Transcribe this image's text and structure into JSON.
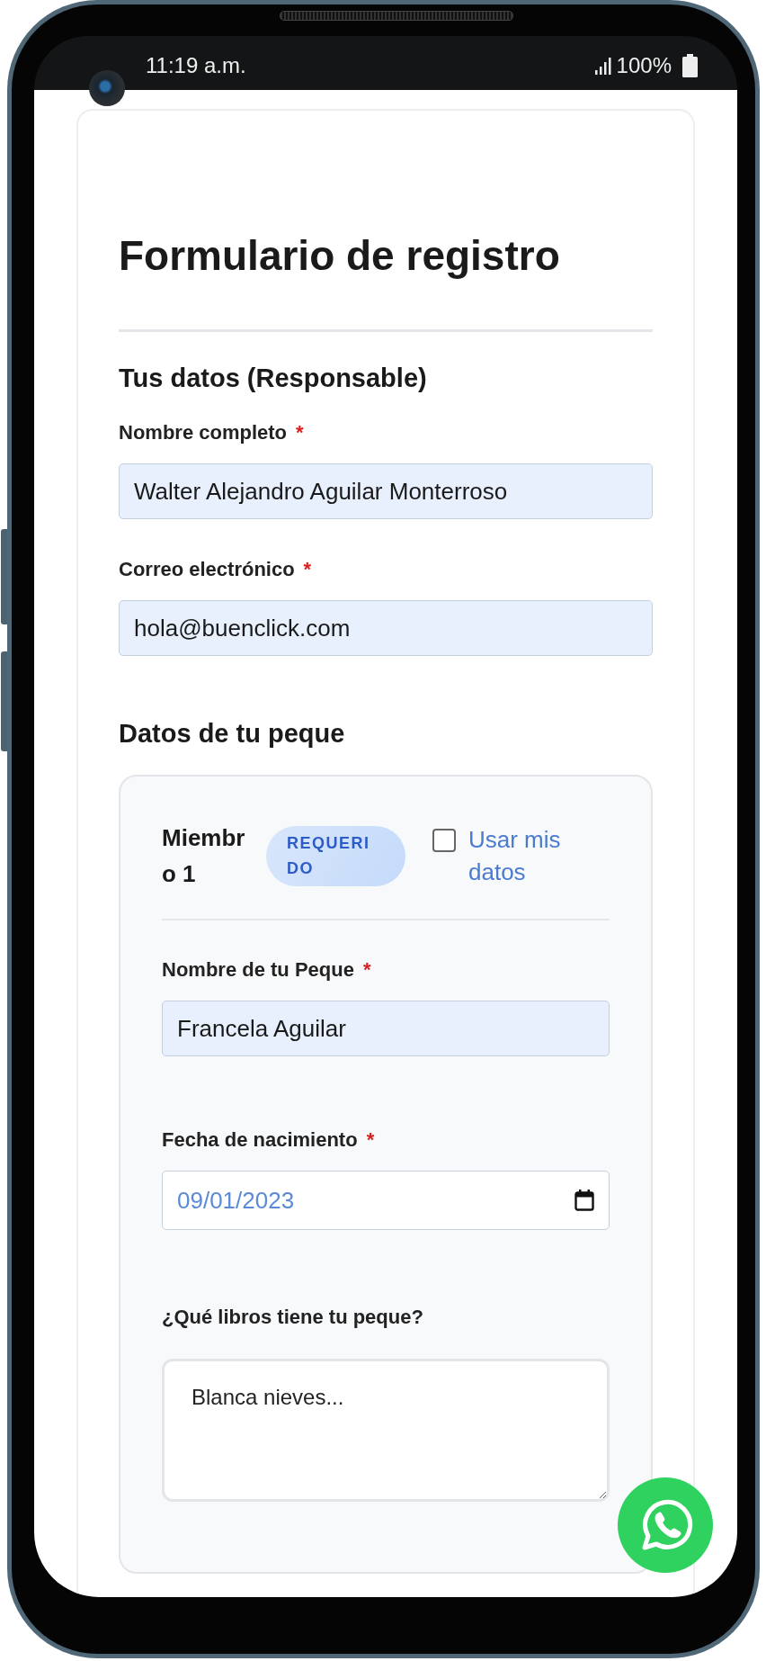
{
  "status_bar": {
    "time": "11:19 a.m.",
    "battery": "100%"
  },
  "form": {
    "title": "Formulario de registro",
    "sections": [
      {
        "title": "Tus datos (Responsable)",
        "fields": [
          {
            "kind": "text",
            "label": "Nombre completo",
            "required_mark": "*",
            "value": "Walter Alejandro Aguilar Monterroso"
          },
          {
            "kind": "text",
            "label": "Correo electrónico",
            "required_mark": "*",
            "value": "hola@buenclick.com"
          }
        ]
      },
      {
        "title": "Datos de tu peque",
        "members": [
          {
            "name": "Miembro 1",
            "badge": "REQUERIDO",
            "use_my_data": {
              "label": "Usar mis datos",
              "checked": false
            },
            "fields": [
              {
                "kind": "text",
                "label": "Nombre de tu Peque",
                "required_mark": "*",
                "value": "Francela Aguilar"
              },
              {
                "kind": "date",
                "label": "Fecha de nacimiento",
                "required_mark": "*",
                "value": "09/01/2023"
              },
              {
                "kind": "textarea",
                "label": "¿Qué libros tiene tu peque?",
                "value": "Blanca nieves..."
              }
            ]
          }
        ]
      }
    ]
  }
}
